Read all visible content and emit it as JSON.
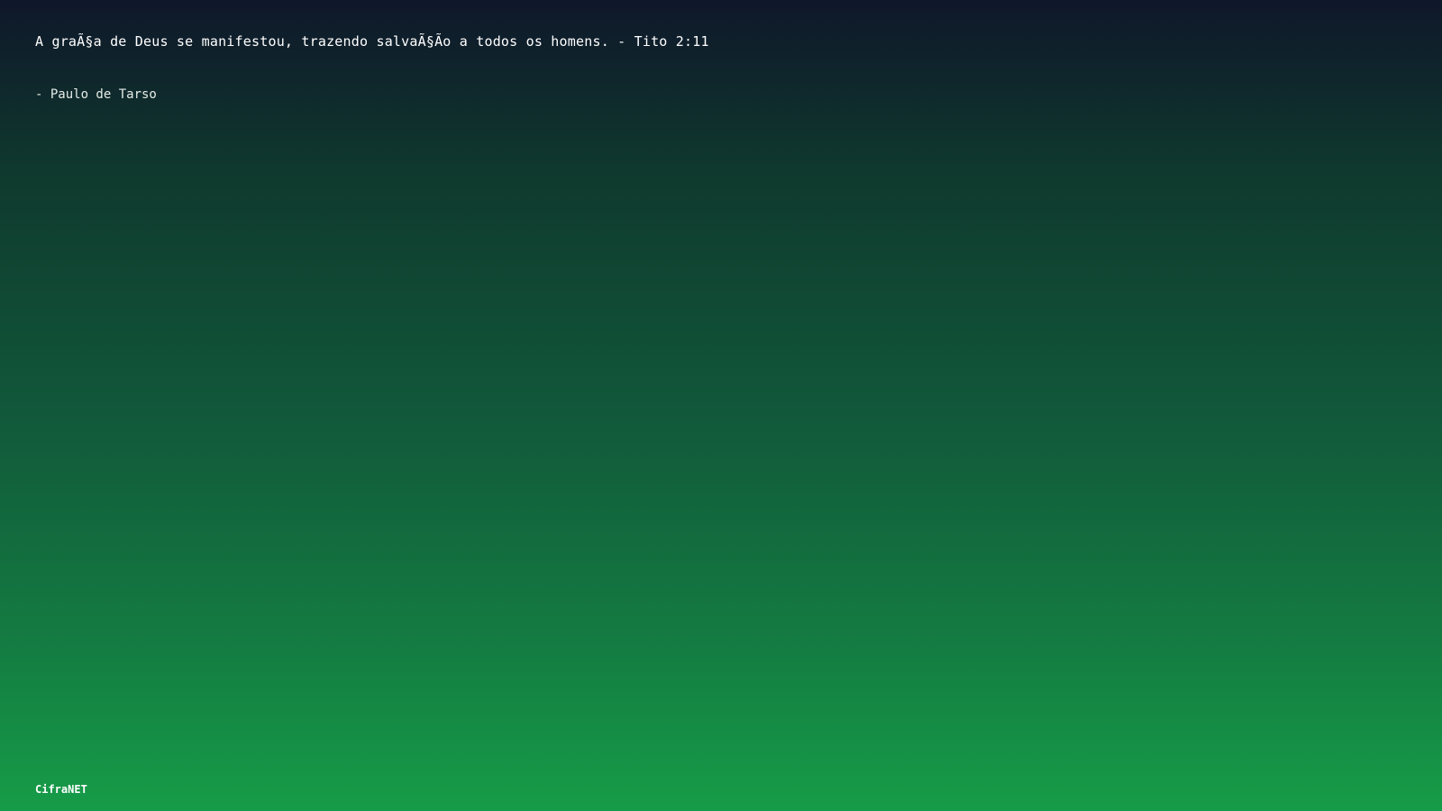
{
  "quote": {
    "text": "A graÃ§a de Deus se manifestou, trazendo salvaÃ§Ão a todos os homens. - Tito 2:11",
    "author": "- Paulo de Tarso"
  },
  "footer": {
    "brand": "CifraNET"
  },
  "colors": {
    "gradient_top": "#0f172a",
    "gradient_bottom": "#169c48",
    "text": "#ffffff"
  }
}
